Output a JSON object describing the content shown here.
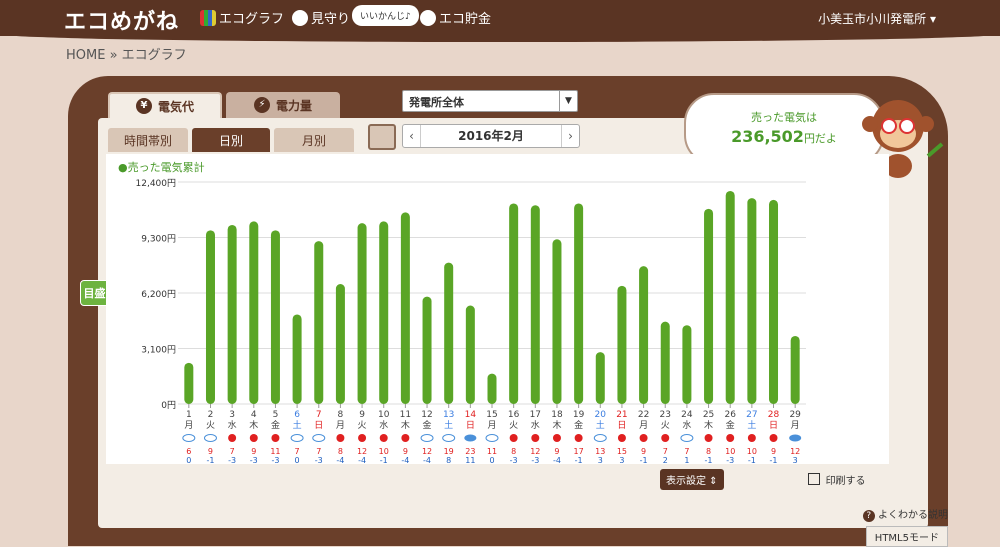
{
  "header": {
    "logo": "エコめがね",
    "nav": [
      "エコグラフ",
      "見守り",
      "エコ貯金"
    ],
    "bubble": "いいかんじ♪",
    "station": "小美玉市小川発電所 ▾"
  },
  "breadcrumb": "HOME » エコグラフ",
  "tabs": {
    "cost": "電気代",
    "power": "電力量",
    "yen_icon": "¥",
    "bolt_icon": "⚡"
  },
  "site_select": "発電所全体",
  "subtabs": [
    "時間帯別",
    "日別",
    "月別"
  ],
  "date": {
    "label": "2016年2月",
    "prev": "‹",
    "next": "›"
  },
  "speech": {
    "line1": "売った電気は",
    "amount": "236,502",
    "unit": "円だよ"
  },
  "mokuji": "目盛 ⇕",
  "controls": {
    "display": "表示設定 ⇕",
    "print": "印刷する"
  },
  "faq": "よくわかる説明",
  "html5": "HTML5モード",
  "colors": {
    "bar": "#5aa526",
    "brown": "#5a3423"
  },
  "chart_data": {
    "type": "bar",
    "legend": "●売った電気累計",
    "yticks": [
      "12,400円",
      "9,300円",
      "6,200円",
      "3,100円",
      "0円"
    ],
    "ylim": [
      0,
      12400
    ],
    "days": [
      "1",
      "2",
      "3",
      "4",
      "5",
      "6",
      "7",
      "8",
      "9",
      "10",
      "11",
      "12",
      "13",
      "14",
      "15",
      "16",
      "17",
      "18",
      "19",
      "20",
      "21",
      "22",
      "23",
      "24",
      "25",
      "26",
      "27",
      "28",
      "29"
    ],
    "weekday": [
      "月",
      "火",
      "水",
      "木",
      "金",
      "土",
      "日",
      "月",
      "火",
      "水",
      "木",
      "金",
      "土",
      "日",
      "月",
      "火",
      "水",
      "木",
      "金",
      "土",
      "日",
      "月",
      "火",
      "水",
      "木",
      "金",
      "土",
      "日",
      "月"
    ],
    "values": [
      2300,
      9700,
      10000,
      10200,
      9700,
      5000,
      9100,
      6700,
      10100,
      10200,
      10700,
      6000,
      7900,
      5500,
      1700,
      11200,
      11100,
      9200,
      11200,
      2900,
      6600,
      7700,
      4600,
      4400,
      10900,
      11900,
      11500,
      11400,
      3800
    ],
    "high": [
      "6",
      "9",
      "7",
      "9",
      "11",
      "7",
      "7",
      "8",
      "12",
      "10",
      "9",
      "12",
      "19",
      "23",
      "11",
      "8",
      "12",
      "9",
      "17",
      "13",
      "15",
      "9",
      "7",
      "7",
      "8",
      "10",
      "10",
      "9",
      "12"
    ],
    "low": [
      "0",
      "-1",
      "-3",
      "-3",
      "-3",
      "0",
      "-3",
      "-4",
      "-4",
      "-1",
      "-4",
      "-4",
      "8",
      "11",
      "0",
      "-3",
      "-3",
      "-4",
      "-1",
      "3",
      "3",
      "-1",
      "2",
      "1",
      "-1",
      "-3",
      "-1",
      "-1",
      "3"
    ],
    "weather": [
      "cloud",
      "cloud",
      "sun",
      "sun",
      "sun",
      "cloud",
      "cloud",
      "sun",
      "sun",
      "sun",
      "sun",
      "cloud",
      "cloud",
      "rain",
      "cloud",
      "sun",
      "sun",
      "sun",
      "sun",
      "cloud",
      "sun",
      "sun",
      "sun",
      "cloud",
      "sun",
      "sun",
      "sun",
      "sun",
      "rain"
    ]
  }
}
